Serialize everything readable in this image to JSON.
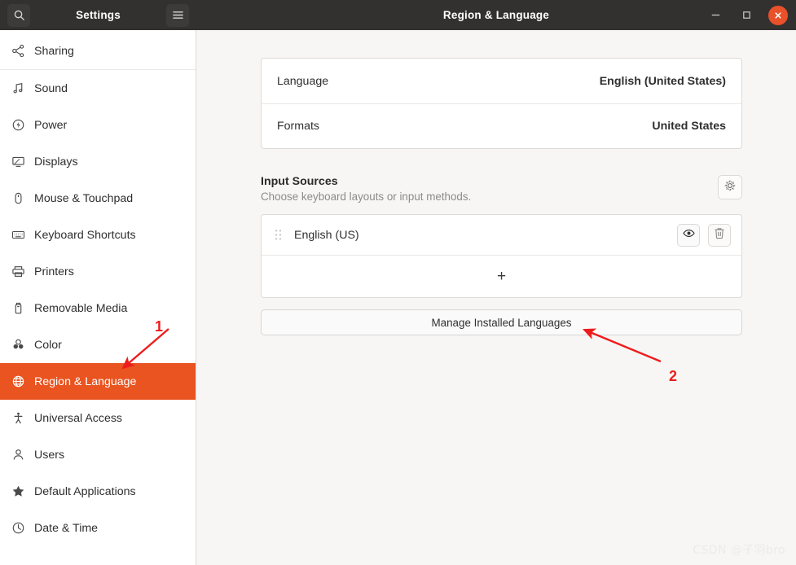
{
  "window": {
    "sidebar_title": "Settings",
    "content_title": "Region & Language",
    "search_icon": "search-icon",
    "menu_icon": "hamburger-menu-icon",
    "minimize_label": "–",
    "maximize_label": "☐",
    "close_label": "×"
  },
  "sidebar": {
    "items": [
      {
        "label": "Sharing",
        "icon": "share-nodes-icon",
        "selected": false,
        "separator_after": true
      },
      {
        "label": "Sound",
        "icon": "music-note-icon",
        "selected": false,
        "separator_after": false
      },
      {
        "label": "Power",
        "icon": "power-bolt-icon",
        "selected": false,
        "separator_after": false
      },
      {
        "label": "Displays",
        "icon": "monitor-icon",
        "selected": false,
        "separator_after": false
      },
      {
        "label": "Mouse & Touchpad",
        "icon": "mouse-icon",
        "selected": false,
        "separator_after": false
      },
      {
        "label": "Keyboard Shortcuts",
        "icon": "keyboard-icon",
        "selected": false,
        "separator_after": false
      },
      {
        "label": "Printers",
        "icon": "printer-icon",
        "selected": false,
        "separator_after": false
      },
      {
        "label": "Removable Media",
        "icon": "usb-drive-icon",
        "selected": false,
        "separator_after": false
      },
      {
        "label": "Color",
        "icon": "color-circles-icon",
        "selected": false,
        "separator_after": false
      },
      {
        "label": "Region & Language",
        "icon": "globe-icon",
        "selected": true,
        "separator_after": false
      },
      {
        "label": "Universal Access",
        "icon": "accessibility-person-icon",
        "selected": false,
        "separator_after": false
      },
      {
        "label": "Users",
        "icon": "user-icon",
        "selected": false,
        "separator_after": false
      },
      {
        "label": "Default Applications",
        "icon": "star-icon",
        "selected": false,
        "separator_after": false
      },
      {
        "label": "Date & Time",
        "icon": "clock-icon",
        "selected": false,
        "separator_after": false
      }
    ]
  },
  "main": {
    "settings_rows": [
      {
        "label": "Language",
        "value": "English (United States)"
      },
      {
        "label": "Formats",
        "value": "United States"
      }
    ],
    "input_sources": {
      "title": "Input Sources",
      "subtitle": "Choose keyboard layouts or input methods.",
      "options_icon": "gear-icon",
      "sources": [
        {
          "name": "English (US)",
          "drag_icon": "drag-handle-icon",
          "preview_icon": "eye-icon",
          "remove_icon": "trash-icon"
        }
      ],
      "add_label": "+",
      "add_icon": "plus-icon"
    },
    "manage_button": "Manage Installed Languages"
  },
  "annotations": [
    {
      "number": "1",
      "color": "#ee1c1c"
    },
    {
      "number": "2",
      "color": "#ee1c1c"
    }
  ],
  "watermark": "CSDN @子羽bro",
  "colors": {
    "accent": "#e95420",
    "titlebar": "#333130",
    "content_bg": "#f7f6f5",
    "card_bg": "#ffffff",
    "border": "#dedad6",
    "annotation": "#ee1c1c"
  }
}
